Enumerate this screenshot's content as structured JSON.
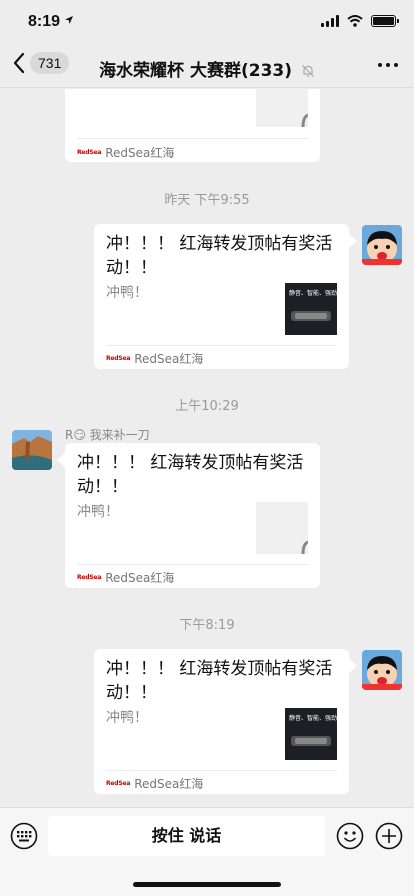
{
  "status_bar": {
    "time": "8:19",
    "icons": [
      "location-arrow-icon",
      "signal-icon",
      "wifi-icon",
      "battery-icon"
    ]
  },
  "header": {
    "back_count": "731",
    "title": "海水荣耀杯 大赛群(233)",
    "mute_icon": "bell-slash-icon",
    "more_icon": "more-icon"
  },
  "messages": [
    {
      "type": "card",
      "side": "left",
      "partial": true,
      "source": "RedSea红海"
    },
    {
      "type": "time",
      "text": "昨天 下午9:55"
    },
    {
      "type": "card",
      "side": "right",
      "title": "冲！！！ 红海转发顶帖有奖活动！！",
      "desc": "冲鸭！",
      "source": "RedSea红海"
    },
    {
      "type": "time",
      "text": "上午10:29"
    },
    {
      "type": "card",
      "side": "left",
      "sender_prefix": "R",
      "sender_emoji": "😏",
      "sender_suffix": " 我来补一刀",
      "title": "冲！！！ 红海转发顶帖有奖活动！！",
      "desc": "冲鸭！",
      "source": "RedSea红海"
    },
    {
      "type": "time",
      "text": "下午8:19"
    },
    {
      "type": "card",
      "side": "right",
      "title": "冲！！！ 红海转发顶帖有奖活动！！",
      "desc": "冲鸭！",
      "source": "RedSea红海"
    }
  ],
  "thumb_text": "静音、智能、强劲",
  "input_bar": {
    "voice_label": "按住 说话",
    "icons": [
      "keyboard-icon",
      "emoji-icon",
      "plus-icon"
    ]
  }
}
